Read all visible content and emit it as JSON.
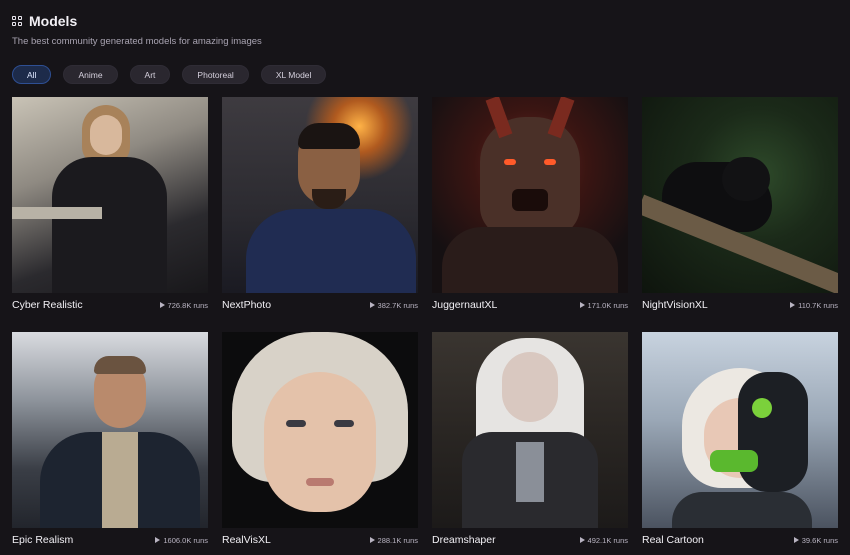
{
  "header": {
    "icon": "grid-icon",
    "title": "Models",
    "subtitle": "The best community generated models for amazing images"
  },
  "filters": [
    {
      "label": "All",
      "active": true
    },
    {
      "label": "Anime",
      "active": false
    },
    {
      "label": "Art",
      "active": false
    },
    {
      "label": "Photoreal",
      "active": false
    },
    {
      "label": "XL Model",
      "active": false
    }
  ],
  "models": [
    {
      "name": "Cyber Realistic",
      "runs": "726.8K runs"
    },
    {
      "name": "NextPhoto",
      "runs": "382.7K runs"
    },
    {
      "name": "JuggernautXL",
      "runs": "171.0K runs"
    },
    {
      "name": "NightVisionXL",
      "runs": "110.7K runs"
    },
    {
      "name": "Epic Realism",
      "runs": "1606.0K runs"
    },
    {
      "name": "RealVisXL",
      "runs": "288.1K runs"
    },
    {
      "name": "Dreamshaper",
      "runs": "492.1K runs"
    },
    {
      "name": "Real Cartoon",
      "runs": "39.6K runs"
    }
  ],
  "colors": {
    "background": "#161418",
    "chip": "#2a272f",
    "chip_active": "#1d2b4a",
    "accent_border": "#2e4f93"
  }
}
